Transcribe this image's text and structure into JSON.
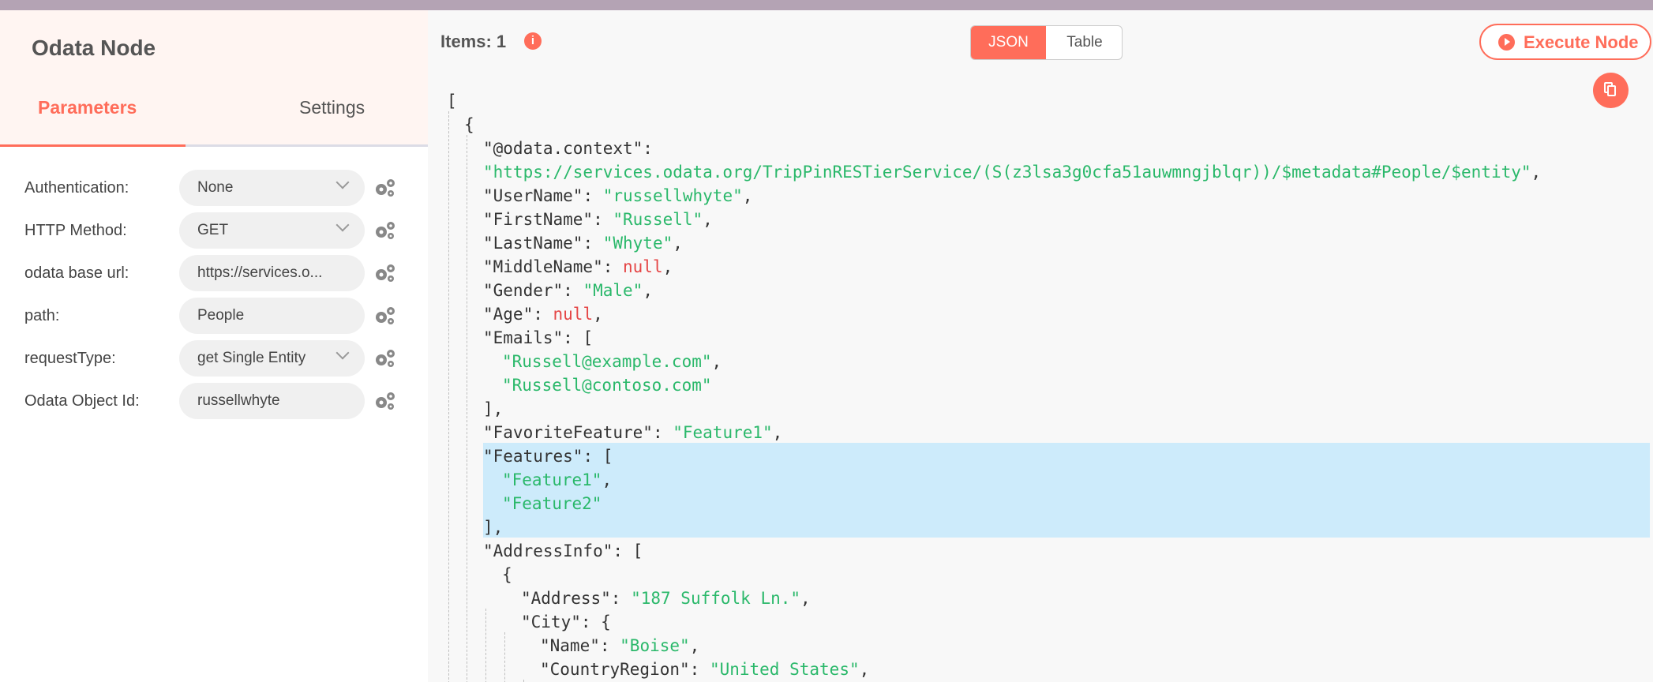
{
  "node": {
    "title": "Odata Node",
    "tabs": {
      "parameters": "Parameters",
      "settings": "Settings"
    }
  },
  "parameters": [
    {
      "label": "Authentication:",
      "value": "None",
      "type": "select"
    },
    {
      "label": "HTTP Method:",
      "value": "GET",
      "type": "select"
    },
    {
      "label": "odata base url:",
      "value": "https://services.o...",
      "type": "input"
    },
    {
      "label": "path:",
      "value": "People",
      "type": "input"
    },
    {
      "label": "requestType:",
      "value": "get Single Entity",
      "type": "select"
    },
    {
      "label": "Odata Object Id:",
      "value": "russellwhyte",
      "type": "input"
    }
  ],
  "output": {
    "items_label": "Items: 1",
    "info_icon": "i",
    "view_toggle": {
      "json": "JSON",
      "table": "Table",
      "selected": "JSON"
    },
    "execute_label": "Execute Node",
    "copy_icon": "copy-icon"
  },
  "json_lines": [
    [
      [
        "p",
        "["
      ]
    ],
    [
      [
        "p",
        "{"
      ]
    ],
    [
      [
        "k",
        "\"@odata.context\""
      ],
      [
        "p",
        ":"
      ]
    ],
    [
      [
        "s",
        "\"https://services.odata.org/TripPinRESTierService/(S(z3lsa3g0cfa51auwmngjblqr))/$metadata#People/$entity\""
      ],
      [
        "p",
        ","
      ]
    ],
    [
      [
        "k",
        "\"UserName\""
      ],
      [
        "p",
        ": "
      ],
      [
        "s",
        "\"russellwhyte\""
      ],
      [
        "p",
        ","
      ]
    ],
    [
      [
        "k",
        "\"FirstName\""
      ],
      [
        "p",
        ": "
      ],
      [
        "s",
        "\"Russell\""
      ],
      [
        "p",
        ","
      ]
    ],
    [
      [
        "k",
        "\"LastName\""
      ],
      [
        "p",
        ": "
      ],
      [
        "s",
        "\"Whyte\""
      ],
      [
        "p",
        ","
      ]
    ],
    [
      [
        "k",
        "\"MiddleName\""
      ],
      [
        "p",
        ": "
      ],
      [
        "n",
        "null"
      ],
      [
        "p",
        ","
      ]
    ],
    [
      [
        "k",
        "\"Gender\""
      ],
      [
        "p",
        ": "
      ],
      [
        "s",
        "\"Male\""
      ],
      [
        "p",
        ","
      ]
    ],
    [
      [
        "k",
        "\"Age\""
      ],
      [
        "p",
        ": "
      ],
      [
        "n",
        "null"
      ],
      [
        "p",
        ","
      ]
    ],
    [
      [
        "k",
        "\"Emails\""
      ],
      [
        "p",
        ": ["
      ]
    ],
    [
      [
        "s",
        "\"Russell@example.com\""
      ],
      [
        "p",
        ","
      ]
    ],
    [
      [
        "s",
        "\"Russell@contoso.com\""
      ]
    ],
    [
      [
        "p",
        "],"
      ]
    ],
    [
      [
        "k",
        "\"FavoriteFeature\""
      ],
      [
        "p",
        ": "
      ],
      [
        "s",
        "\"Feature1\""
      ],
      [
        "p",
        ","
      ]
    ],
    [
      [
        "k",
        "\"Features\""
      ],
      [
        "p",
        ": ["
      ]
    ],
    [
      [
        "s",
        "\"Feature1\""
      ],
      [
        "p",
        ","
      ]
    ],
    [
      [
        "s",
        "\"Feature2\""
      ]
    ],
    [
      [
        "p",
        "],"
      ]
    ],
    [
      [
        "k",
        "\"AddressInfo\""
      ],
      [
        "p",
        ": ["
      ]
    ],
    [
      [
        "p",
        "{"
      ]
    ],
    [
      [
        "k",
        "\"Address\""
      ],
      [
        "p",
        ": "
      ],
      [
        "s",
        "\"187 Suffolk Ln.\""
      ],
      [
        "p",
        ","
      ]
    ],
    [
      [
        "k",
        "\"City\""
      ],
      [
        "p",
        ": {"
      ]
    ],
    [
      [
        "k",
        "\"Name\""
      ],
      [
        "p",
        ": "
      ],
      [
        "s",
        "\"Boise\""
      ],
      [
        "p",
        ","
      ]
    ],
    [
      [
        "k",
        "\"CountryRegion\""
      ],
      [
        "p",
        ": "
      ],
      [
        "s",
        "\"United States\""
      ],
      [
        "p",
        ","
      ]
    ]
  ]
}
